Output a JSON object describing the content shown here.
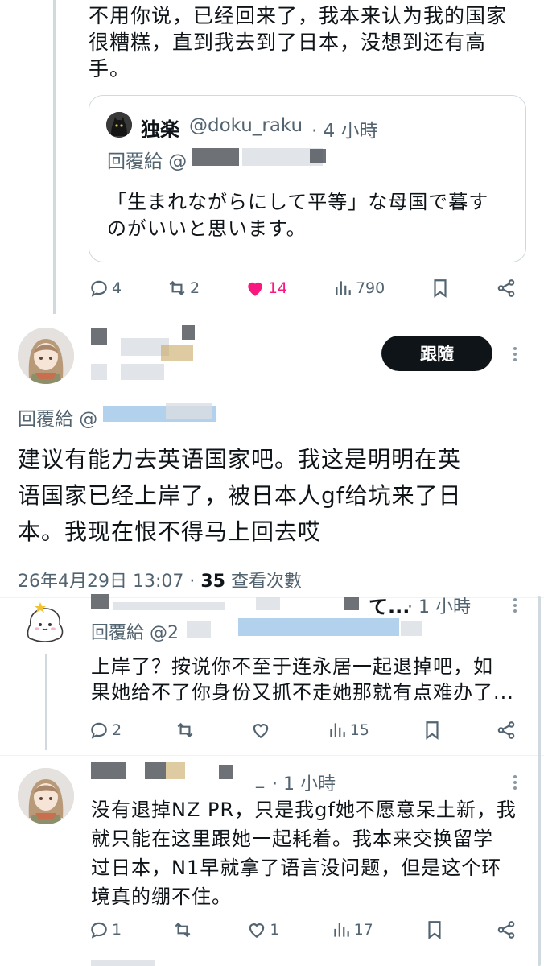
{
  "post1": {
    "body_lines": [
      "不用你说，已经回来了，我本来认为我的国家",
      "很糟糕，直到我去到了日本，没想到还有高",
      "手。"
    ],
    "quote": {
      "author": "独楽",
      "handle": "@doku_raku",
      "time": "· 4 小時",
      "reply_prefix": "回覆給 @",
      "body_lines": [
        "「生まれながらにして平等」な母国で暮す",
        "のがいいと思います。"
      ]
    },
    "stats": {
      "replies": "4",
      "reposts": "2",
      "likes": "14",
      "views": "790"
    }
  },
  "main_post": {
    "follow_label": "跟隨",
    "reply_prefix": "回覆給 @",
    "body_lines": [
      "建议有能力去英语国家吧。我这是明明在英",
      "语国家已经上岸了，被日本人gf给坑来了日",
      "本。我现在恨不得马上回去哎"
    ],
    "date": "26年4月29日 13:07 ·",
    "views_count": "35",
    "views_label": "查看次數"
  },
  "reply1": {
    "name_tail": "て...",
    "time": "· 1 小時",
    "reply_prefix": "回覆給 @2",
    "body_lines": [
      "上岸了？按说你不至于连永居一起退掉吧，如",
      "果她给不了你身份又抓不走她那就有点难办了..."
    ],
    "stats": {
      "replies": "2",
      "reposts": "",
      "likes": "",
      "views": "15"
    }
  },
  "reply2": {
    "name_tail": "_",
    "time": "· 1 小時",
    "body_lines": [
      "没有退掉NZ PR，只是我gf她不愿意呆土新，我",
      "就只能在这里跟她一起耗着。我本来交换留学",
      "过日本，N1早就拿了语言没问题，但是这个环",
      "境真的绷不住。"
    ],
    "stats": {
      "replies": "1",
      "reposts": "",
      "likes": "1",
      "views": "17"
    }
  },
  "colors": {
    "like_active": "#f91880",
    "follow_bg": "#0f1419",
    "muted": "#536471"
  }
}
